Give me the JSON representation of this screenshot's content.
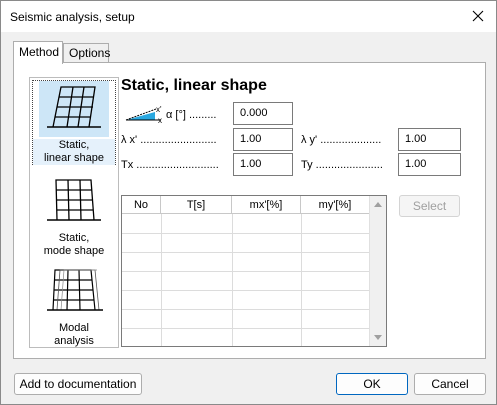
{
  "window": {
    "title": "Seismic analysis, setup"
  },
  "tabs": [
    {
      "label": "Method",
      "active": true
    },
    {
      "label": "Options",
      "active": false
    }
  ],
  "methods": [
    {
      "label_line1": "Static,",
      "label_line2": "linear shape",
      "selected": true,
      "icon": "frame-linear-icon"
    },
    {
      "label_line1": "Static,",
      "label_line2": "mode shape",
      "selected": false,
      "icon": "frame-mode-icon"
    },
    {
      "label_line1": "Modal",
      "label_line2": "analysis",
      "selected": false,
      "icon": "frame-modal-icon"
    }
  ],
  "section": {
    "title": "Static, linear shape",
    "alpha_label": "α [°] .........",
    "alpha_value": "0.000",
    "lambda_x_label": "λ x' .........................",
    "lambda_x_value": "1.00",
    "lambda_y_label": "λ y' ....................",
    "lambda_y_value": "1.00",
    "tx_label": "Tx ...........................",
    "tx_value": "1.00",
    "ty_label": "Ty ......................",
    "ty_value": "1.00",
    "axis_x_label": "x'",
    "axis_x_label2": "x"
  },
  "table": {
    "columns": [
      "No",
      "T[s]",
      "mx'[%]",
      "my'[%]"
    ],
    "rows": []
  },
  "buttons": {
    "select": "Select",
    "add_to_documentation": "Add to documentation",
    "ok": "OK",
    "cancel": "Cancel"
  },
  "colors": {
    "selection_bg": "#cde6f7",
    "primary_border": "#0067c0",
    "angle_fill": "#2aa8e0"
  }
}
